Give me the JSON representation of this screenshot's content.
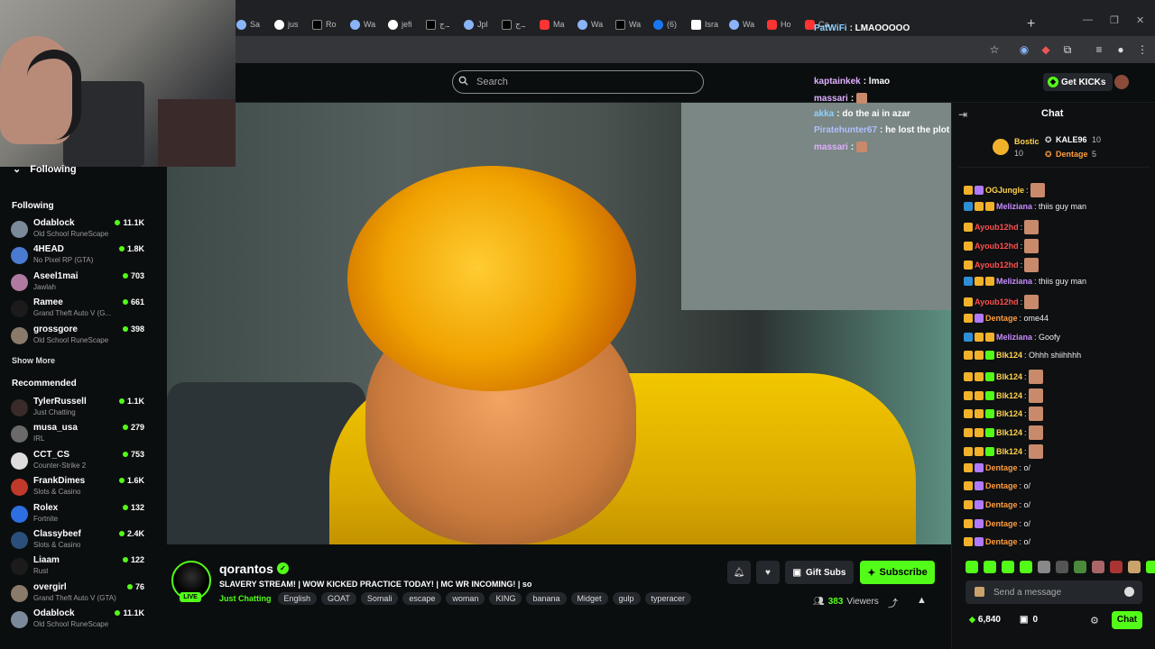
{
  "browser": {
    "tabs": [
      {
        "label": "Sa",
        "fav": "plain"
      },
      {
        "label": "jus",
        "fav": "g"
      },
      {
        "label": "Ro",
        "fav": "x"
      },
      {
        "label": "Wa",
        "fav": "plain"
      },
      {
        "label": "jefi",
        "fav": "g"
      },
      {
        "label": "ـ.ج",
        "fav": "x"
      },
      {
        "label": "Jpl",
        "fav": "plain"
      },
      {
        "label": "ـ.ج",
        "fav": "x"
      },
      {
        "label": "Ma",
        "fav": "y"
      },
      {
        "label": "Wa",
        "fav": "plain"
      },
      {
        "label": "Wa",
        "fav": "x"
      },
      {
        "label": "(6)",
        "fav": "f"
      },
      {
        "label": "Isra",
        "fav": "w"
      },
      {
        "label": "Wa",
        "fav": "plain"
      },
      {
        "label": "Ho",
        "fav": "y"
      },
      {
        "label": "Ca",
        "fav": "y"
      }
    ],
    "new_tab": "+"
  },
  "header": {
    "search_placeholder": "Search",
    "get_kicks_label": "Get KICKs"
  },
  "sidebar": {
    "following_header": "Following",
    "following_section": "Following",
    "following": [
      {
        "name": "Odablock",
        "category": "Old School RuneScape",
        "viewers": "11.1K",
        "color": "#7a8a9a"
      },
      {
        "name": "4HEAD",
        "category": "No Pixel RP (GTA)",
        "viewers": "1.8K",
        "color": "#4a7bd0"
      },
      {
        "name": "Aseel1mai",
        "category": "Jawlah",
        "viewers": "703",
        "color": "#b07aa0"
      },
      {
        "name": "Ramee",
        "category": "Grand Theft Auto V (G...",
        "viewers": "661",
        "color": "#1b1b1b"
      },
      {
        "name": "grossgore",
        "category": "Old School RuneScape",
        "viewers": "398",
        "color": "#8a7a6a"
      }
    ],
    "show_more": "Show More",
    "recommended_section": "Recommended",
    "recommended": [
      {
        "name": "TylerRussell",
        "category": "Just Chatting",
        "viewers": "1.1K",
        "color": "#3a2a2a"
      },
      {
        "name": "musa_usa",
        "category": "IRL",
        "viewers": "279",
        "color": "#6a6a6a"
      },
      {
        "name": "CCT_CS",
        "category": "Counter-Strike 2",
        "viewers": "753",
        "color": "#dddddd"
      },
      {
        "name": "FrankDimes",
        "category": "Slots & Casino",
        "viewers": "1.6K",
        "color": "#c0392b"
      },
      {
        "name": "Rolex",
        "category": "Fortnite",
        "viewers": "132",
        "color": "#2d6fe0"
      },
      {
        "name": "Classybeef",
        "category": "Slots & Casino",
        "viewers": "2.4K",
        "color": "#2a4f7a"
      },
      {
        "name": "Liaam",
        "category": "Rust",
        "viewers": "122",
        "color": "#1b1b1b"
      },
      {
        "name": "overgirl",
        "category": "Grand Theft Auto V (GTA)",
        "viewers": "76",
        "color": "#8a7a6a"
      },
      {
        "name": "Odablock",
        "category": "Old School RuneScape",
        "viewers": "11.1K",
        "color": "#7a8a9a"
      }
    ]
  },
  "overlay_chat": [
    {
      "user": "PatWiFi",
      "text": ": LMAOOOOO",
      "color": "#8fd3ff",
      "emote": false
    },
    {
      "user": "kaptainkek",
      "text": ": lmao",
      "color": "#e0b0ff",
      "emote": false
    },
    {
      "user": "massari",
      "text": ":",
      "color": "#e0b0ff",
      "emote": true
    },
    {
      "user": "akka",
      "text": ": do the ai in azar",
      "color": "#8fd3ff",
      "emote": false
    },
    {
      "user": "Piratehunter67",
      "text": ": he lost the plot",
      "color": "#b0c0ff",
      "emote": false
    },
    {
      "user": "massari",
      "text": ":",
      "color": "#e0b0ff",
      "emote": true
    }
  ],
  "chat": {
    "title": "Chat",
    "leaderboard": [
      {
        "name": "Bostic",
        "count": "10"
      },
      {
        "name": "KALE96",
        "count": "10"
      },
      {
        "name": "Dentage",
        "count": "5"
      }
    ],
    "messages": [
      {
        "user": "OGJungle",
        "text": ":",
        "color": "#ffd34d",
        "emote": true
      },
      {
        "user": "Meliziana",
        "text": ": thiis guy man",
        "color": "#c88cff",
        "emote": false
      },
      {
        "user": "Ayoub12hd",
        "text": ":",
        "color": "#ff4d4d",
        "emote": true
      },
      {
        "user": "Ayoub12hd",
        "text": ":",
        "color": "#ff4d4d",
        "emote": true
      },
      {
        "user": "Ayoub12hd",
        "text": ":",
        "color": "#ff4d4d",
        "emote": true
      },
      {
        "user": "Meliziana",
        "text": ": thiis guy man",
        "color": "#c88cff",
        "emote": false
      },
      {
        "user": "Ayoub12hd",
        "text": ":",
        "color": "#ff4d4d",
        "emote": true
      },
      {
        "user": "Dentage",
        "text": ": ome44",
        "color": "#ff9d3d",
        "emote": false
      },
      {
        "user": "Meliziana",
        "text": ": Goofy",
        "color": "#c88cff",
        "emote": false
      },
      {
        "user": "Blk124",
        "text": ": Ohhh shiihhhh",
        "color": "#ffd34d",
        "emote": false
      },
      {
        "user": "Blk124",
        "text": ":",
        "color": "#ffd34d",
        "emote": true
      },
      {
        "user": "Blk124",
        "text": ":",
        "color": "#ffd34d",
        "emote": true
      },
      {
        "user": "Blk124",
        "text": ":",
        "color": "#ffd34d",
        "emote": true
      },
      {
        "user": "Blk124",
        "text": ":",
        "color": "#ffd34d",
        "emote": true
      },
      {
        "user": "Blk124",
        "text": ":",
        "color": "#ffd34d",
        "emote": true
      },
      {
        "user": "Dentage",
        "text": ": o/",
        "color": "#ff9d3d",
        "emote": false
      },
      {
        "user": "Dentage",
        "text": ": o/",
        "color": "#ff9d3d",
        "emote": false
      },
      {
        "user": "Dentage",
        "text": ": o/",
        "color": "#ff9d3d",
        "emote": false
      },
      {
        "user": "Dentage",
        "text": ": o/",
        "color": "#ff9d3d",
        "emote": false
      },
      {
        "user": "Dentage",
        "text": ": o/",
        "color": "#ff9d3d",
        "emote": false
      }
    ],
    "send_placeholder": "Send a message",
    "kicks_balance": "6,840",
    "gift_balance": "0",
    "chat_button": "Chat"
  },
  "stream": {
    "channel": "qorantos",
    "live_label": "LIVE",
    "title": "SLAVERY STREAM! | WOW KICKED PRACTICE TODAY! | MC WR INCOMING! | so",
    "category": "Just Chatting",
    "tags": [
      "English",
      "GOAT",
      "Somali",
      "escape",
      "woman",
      "KING",
      "banana",
      "Midget",
      "gulp",
      "typeracer"
    ],
    "gift_subs_label": "Gift Subs",
    "subscribe_label": "Subscribe",
    "viewer_count": "383",
    "viewers_label": "Viewers"
  },
  "colors": {
    "accent": "#53fc18",
    "background": "#0b0e0f"
  }
}
